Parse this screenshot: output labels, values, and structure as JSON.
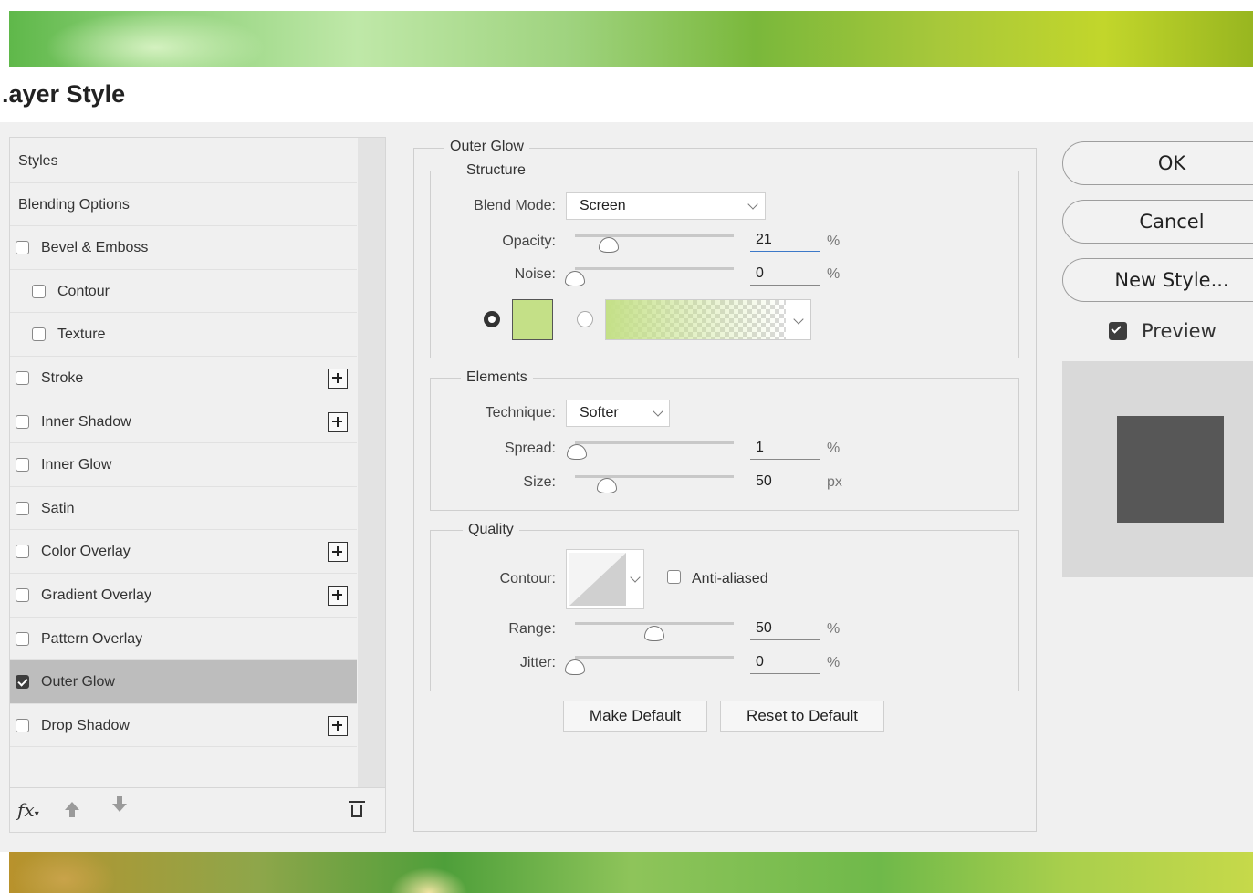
{
  "dialog": {
    "title": ".ayer Style"
  },
  "styles_panel": {
    "items": [
      {
        "label": "Styles",
        "checkbox": null,
        "plus": false,
        "indent": 0,
        "selected": false
      },
      {
        "label": "Blending Options",
        "checkbox": null,
        "plus": false,
        "indent": 0,
        "selected": false
      },
      {
        "label": "Bevel & Emboss",
        "checkbox": false,
        "plus": false,
        "indent": 0,
        "selected": false
      },
      {
        "label": "Contour",
        "checkbox": false,
        "plus": false,
        "indent": 1,
        "selected": false
      },
      {
        "label": "Texture",
        "checkbox": false,
        "plus": false,
        "indent": 1,
        "selected": false
      },
      {
        "label": "Stroke",
        "checkbox": false,
        "plus": true,
        "indent": 0,
        "selected": false
      },
      {
        "label": "Inner Shadow",
        "checkbox": false,
        "plus": true,
        "indent": 0,
        "selected": false
      },
      {
        "label": "Inner Glow",
        "checkbox": false,
        "plus": false,
        "indent": 0,
        "selected": false
      },
      {
        "label": "Satin",
        "checkbox": false,
        "plus": false,
        "indent": 0,
        "selected": false
      },
      {
        "label": "Color Overlay",
        "checkbox": false,
        "plus": true,
        "indent": 0,
        "selected": false
      },
      {
        "label": "Gradient Overlay",
        "checkbox": false,
        "plus": true,
        "indent": 0,
        "selected": false
      },
      {
        "label": "Pattern Overlay",
        "checkbox": false,
        "plus": false,
        "indent": 0,
        "selected": false
      },
      {
        "label": "Outer Glow",
        "checkbox": true,
        "plus": false,
        "indent": 0,
        "selected": true
      },
      {
        "label": "Drop Shadow",
        "checkbox": false,
        "plus": true,
        "indent": 0,
        "selected": false
      }
    ],
    "footer_icons": [
      "fx-icon",
      "move-up-icon",
      "move-down-icon",
      "trash-icon"
    ],
    "fx_label": "fx"
  },
  "outer_glow": {
    "title": "Outer Glow",
    "structure": {
      "title": "Structure",
      "blend_mode_label": "Blend Mode:",
      "blend_mode_value": "Screen",
      "opacity_label": "Opacity:",
      "opacity_value": "21",
      "opacity_level": 0.21,
      "opacity_unit": "%",
      "noise_label": "Noise:",
      "noise_value": "0",
      "noise_level": 0,
      "noise_unit": "%",
      "glow_color": "#c4e087",
      "color_mode": "solid"
    },
    "elements": {
      "title": "Elements",
      "technique_label": "Technique:",
      "technique_value": "Softer",
      "spread_label": "Spread:",
      "spread_value": "1",
      "spread_level": 0.01,
      "spread_unit": "%",
      "size_label": "Size:",
      "size_value": "50",
      "size_level": 0.2,
      "size_unit": "px"
    },
    "quality": {
      "title": "Quality",
      "contour_label": "Contour:",
      "anti_aliased_label": "Anti-aliased",
      "anti_aliased_checked": false,
      "range_label": "Range:",
      "range_value": "50",
      "range_level": 0.5,
      "range_unit": "%",
      "jitter_label": "Jitter:",
      "jitter_value": "0",
      "jitter_level": 0,
      "jitter_unit": "%"
    },
    "make_default_label": "Make Default",
    "reset_default_label": "Reset to Default"
  },
  "right_panel": {
    "ok_label": "OK",
    "cancel_label": "Cancel",
    "new_style_label": "New Style...",
    "preview_label": "Preview",
    "preview_checked": true,
    "preview_swatch_color": "#575757"
  }
}
